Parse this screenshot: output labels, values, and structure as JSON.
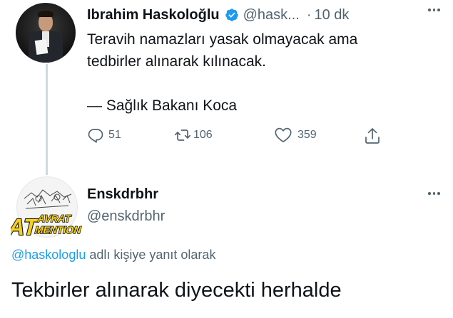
{
  "tweet": {
    "author_name": "Ibrahim Haskoloğlu",
    "author_handle": "@hask...",
    "time": "10 dk",
    "text": "Teravih namazları yasak olmayacak ama\ntedbirler alınarak kılınacak.\n\n— Sağlık Bakanı Koca",
    "reply_count": "51",
    "retweet_count": "106",
    "like_count": "359",
    "verified_color": "#1d9bf0"
  },
  "reply": {
    "author_name": "Enskdrbhr",
    "author_handle": "@enskdrbhr",
    "avatar_logo": {
      "big": "AT",
      "line1": "AVRAT",
      "line2": "MENTION"
    },
    "reply_to_mention": "@haskologlu",
    "reply_to_suffix": "adlı kişiye yanıt olarak",
    "text": "Tekbirler alınarak diyecekti herhalde"
  },
  "colors": {
    "accent": "#1d9bf0",
    "secondary_text": "#536471",
    "logo_yellow": "#f7d117"
  }
}
